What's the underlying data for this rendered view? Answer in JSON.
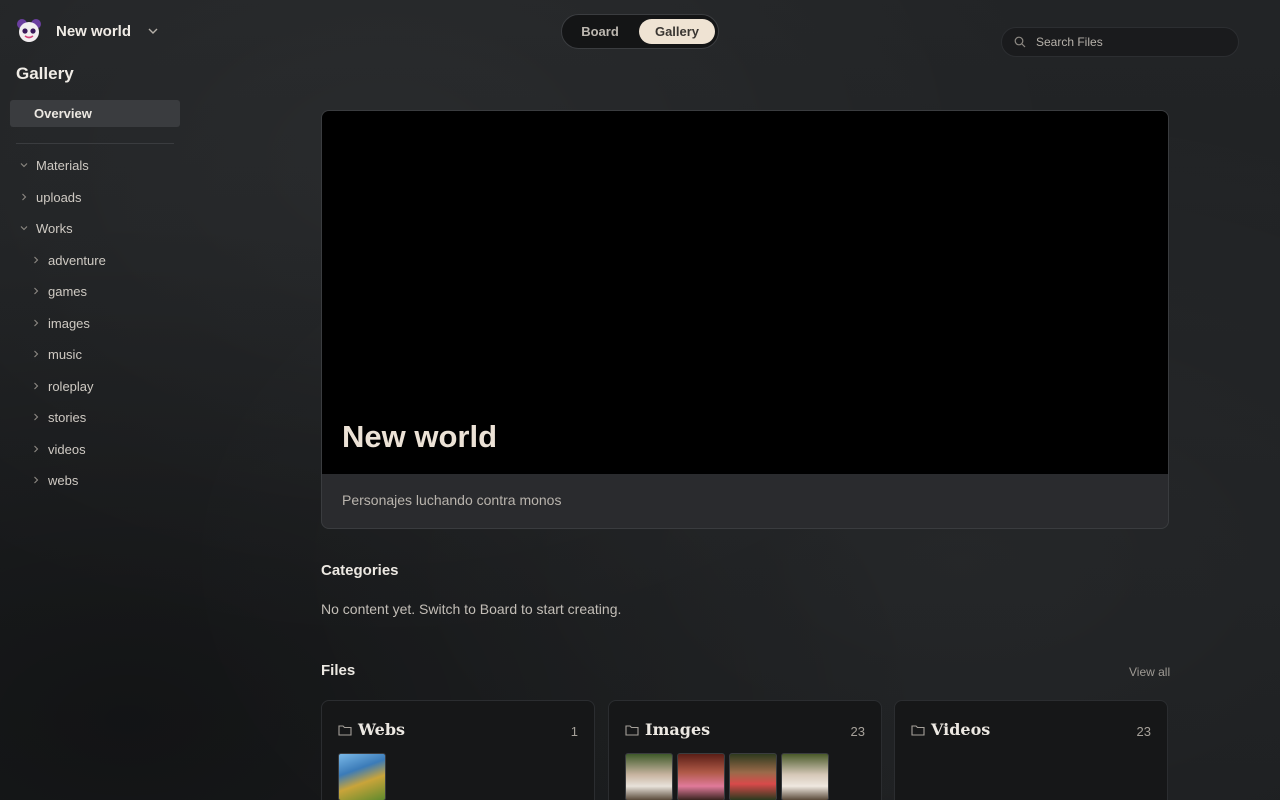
{
  "workspace": {
    "name": "New world"
  },
  "sidebar": {
    "section_title": "Gallery",
    "overview_label": "Overview",
    "tree": [
      {
        "label": "Materials",
        "expanded": true,
        "depth": 0
      },
      {
        "label": "uploads",
        "expanded": false,
        "depth": 0
      },
      {
        "label": "Works",
        "expanded": true,
        "depth": 0
      },
      {
        "label": "adventure",
        "expanded": false,
        "depth": 1
      },
      {
        "label": "games",
        "expanded": false,
        "depth": 1
      },
      {
        "label": "images",
        "expanded": false,
        "depth": 1
      },
      {
        "label": "music",
        "expanded": false,
        "depth": 1
      },
      {
        "label": "roleplay",
        "expanded": false,
        "depth": 1
      },
      {
        "label": "stories",
        "expanded": false,
        "depth": 1
      },
      {
        "label": "videos",
        "expanded": false,
        "depth": 1
      },
      {
        "label": "webs",
        "expanded": false,
        "depth": 1
      }
    ]
  },
  "topbar": {
    "toggle": {
      "board_label": "Board",
      "gallery_label": "Gallery",
      "active": "Gallery"
    },
    "search": {
      "placeholder": "Search Files",
      "value": ""
    }
  },
  "hero": {
    "title": "New world",
    "description": "Personajes luchando contra monos"
  },
  "categories": {
    "heading": "Categories",
    "empty_text": "No content yet. Switch to Board to start creating."
  },
  "files": {
    "heading": "Files",
    "view_all": "View all",
    "cards": [
      {
        "title": "Webs",
        "count": "1"
      },
      {
        "title": "Images",
        "count": "23"
      },
      {
        "title": "Videos",
        "count": "23"
      }
    ]
  },
  "colors": {
    "accent": "#efe3d3",
    "background": "#1f2123",
    "hero_banner": "#000000"
  }
}
